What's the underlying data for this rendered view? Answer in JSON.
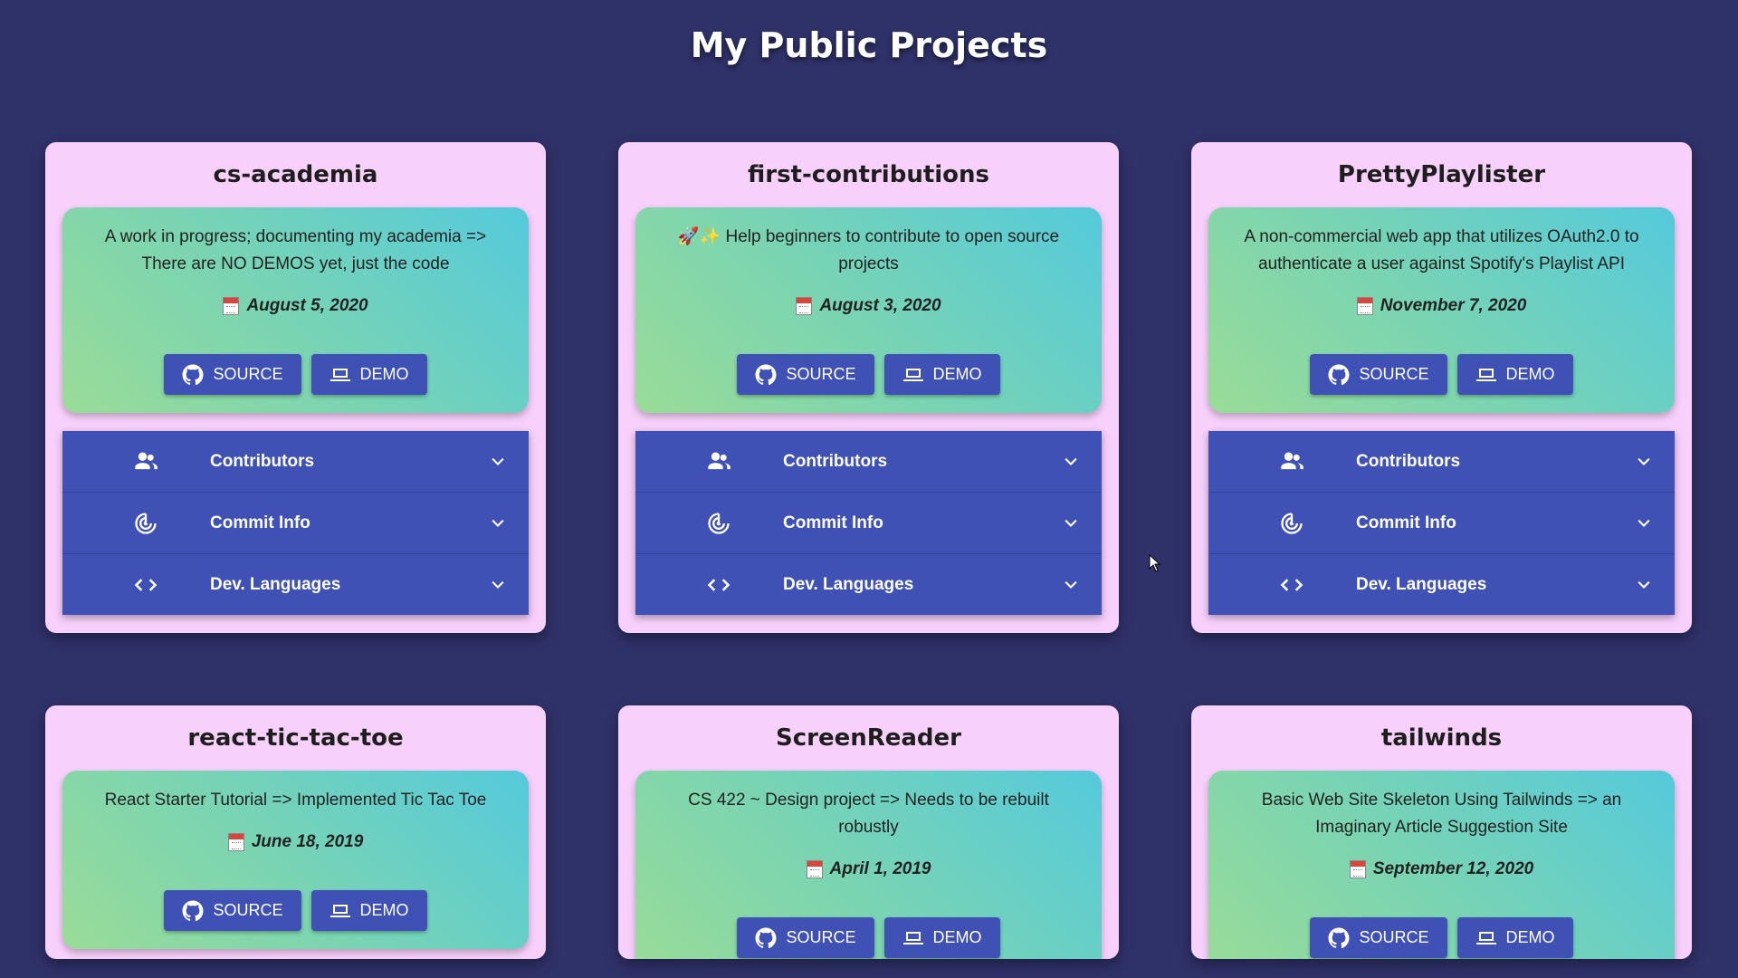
{
  "page": {
    "title": "My Public Projects"
  },
  "buttons": {
    "source": "SOURCE",
    "demo": "DEMO"
  },
  "accordion": {
    "contributors": "Contributors",
    "commit_info": "Commit Info",
    "dev_languages": "Dev. Languages"
  },
  "projects": [
    {
      "name": "cs-academia",
      "description": "A work in progress; documenting my academia => There are NO DEMOS yet, just the code",
      "date": "August 5, 2020"
    },
    {
      "name": "first-contributions",
      "description": "🚀✨ Help beginners to contribute to open source projects",
      "date": "August 3, 2020"
    },
    {
      "name": "PrettyPlaylister",
      "description": "A non-commercial web app that utilizes OAuth2.0 to authenticate a user against Spotify's Playlist API",
      "date": "November 7, 2020"
    },
    {
      "name": "react-tic-tac-toe",
      "description": "React Starter Tutorial => Implemented Tic Tac Toe",
      "date": "June 18, 2019"
    },
    {
      "name": "ScreenReader",
      "description": "CS 422 ~ Design project => Needs to be rebuilt robustly",
      "date": "April 1, 2019"
    },
    {
      "name": "tailwinds",
      "description": "Basic Web Site Skeleton Using Tailwinds => an Imaginary Article Suggestion Site",
      "date": "September 12, 2020"
    }
  ]
}
